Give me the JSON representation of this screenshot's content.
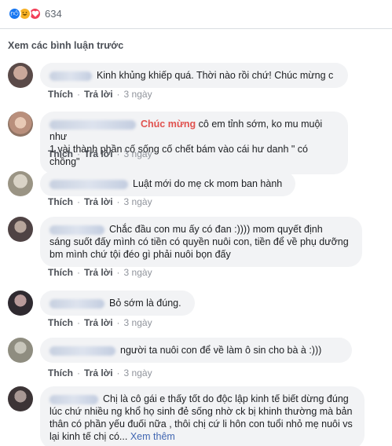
{
  "reactions": {
    "count": "634",
    "icons": [
      "like",
      "haha",
      "love"
    ]
  },
  "view_previous": "Xem các bình luận trước",
  "actions": {
    "like": "Thích",
    "reply": "Trả lời",
    "dot": "·"
  },
  "comments": [
    {
      "text": "Kinh khủng khiếp quá. Thời nào rồi chứ! Chúc mừng c",
      "time": "3 ngày"
    },
    {
      "highlight": "Chúc mừng",
      "text_line1": " cô em tỉnh sớm, ko mu muội như",
      "text_rest": "1 vài thành phần cố sống cố chết bám vào cái hư danh \" có chồng\"",
      "time": "3 ngày"
    },
    {
      "text": "Luật mới do mẹ ck mom ban hành",
      "time": "3 ngày"
    },
    {
      "text_line1": "Chắc đầu con mu ấy có đan :)))) mom quyết định",
      "text_rest": "sáng suốt đấy mình có tiền có quyền nuôi con, tiền để về phụ dưỡng bm mình chứ tội đéo gì phải nuôi bọn đấy",
      "time": "3 ngày"
    },
    {
      "text": "Bỏ sớm là đúng.",
      "time": "3 ngày"
    },
    {
      "text": "người ta nuôi con để về làm ô sin cho bà à :)))",
      "time": "3 ngày"
    },
    {
      "text_line1": "Chị là cô gái e thấy tốt do độc lập kinh tế biết dừng đúng",
      "text_rest": "lúc chứ nhiều ng khổ họ sinh đẻ sống nhờ ck bị khinh thường mà bản thân có phần yếu đuối nữa , thôi chị cứ li hôn con tuổi nhỏ mẹ nuôi vs lại kinh tế chị có...",
      "see_more": "Xem thêm"
    }
  ]
}
